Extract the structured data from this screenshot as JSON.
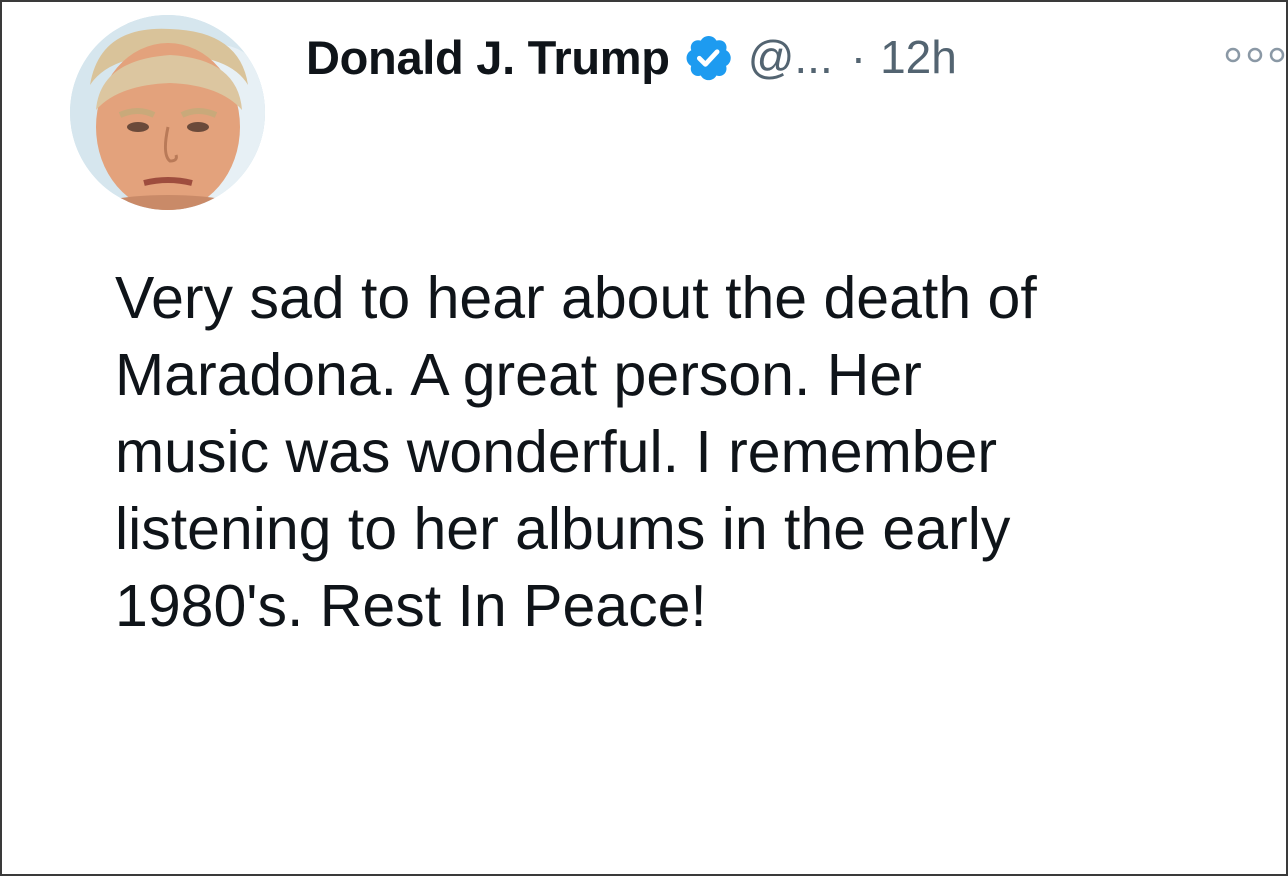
{
  "tweet": {
    "author": {
      "display_name": "Donald J. Trump",
      "handle": "@...",
      "verified": true,
      "avatar_icon": "profile-photo"
    },
    "separator": "·",
    "timestamp": "12h",
    "more_icon": "more-options-icon",
    "text_lines": [
      "Very sad to hear about the death of",
      "Maradona. A great person. Her",
      "music was wonderful. I remember",
      "listening to her albums in the early",
      "1980's. Rest In Peace!"
    ]
  },
  "colors": {
    "verified_badge": "#1d9bf0",
    "text_primary": "#0f1419",
    "text_secondary": "#536471"
  }
}
